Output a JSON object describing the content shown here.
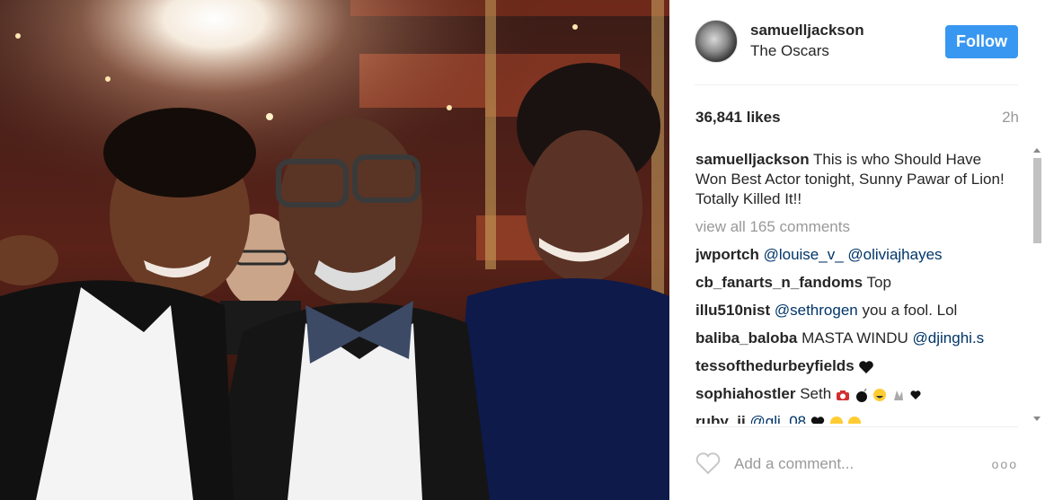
{
  "post": {
    "username": "samuelljackson",
    "location": "The Oscars",
    "follow_label": "Follow",
    "likes": "36,841 likes",
    "time": "2h",
    "caption": "This is who Should Have Won Best Actor tonight, Sunny Pawar of Lion! Totally Killed It!!",
    "view_all": "view all 165 comments",
    "add_comment_placeholder": "Add a comment...",
    "more_label": "ooo"
  },
  "comments": [
    {
      "user": "jwportch",
      "m1": "@louise_v_",
      "m2": "@oliviajhayes"
    },
    {
      "user": "cb_fanarts_n_fandoms",
      "text": "Top"
    },
    {
      "user": "illu510nist",
      "m1": "@sethrogen",
      "text": "you a fool. Lol"
    },
    {
      "user": "baliba_baloba",
      "text": "MASTA WINDU",
      "m1": "@djinghi.s"
    },
    {
      "user": "tessofthedurbeyfields"
    },
    {
      "user": "sophiahostler",
      "text": "Seth"
    },
    {
      "user": "ruby_ii",
      "m1": "@gli_08"
    }
  ],
  "colors": {
    "accent": "#3897f0",
    "mention": "#003569",
    "muted": "#999999"
  },
  "icons": [
    "heart-icon",
    "more-options-icon",
    "camera-emoji",
    "bomb-emoji",
    "grin-emoji",
    "black-heart-emoji",
    "crying-laugh-emoji"
  ]
}
